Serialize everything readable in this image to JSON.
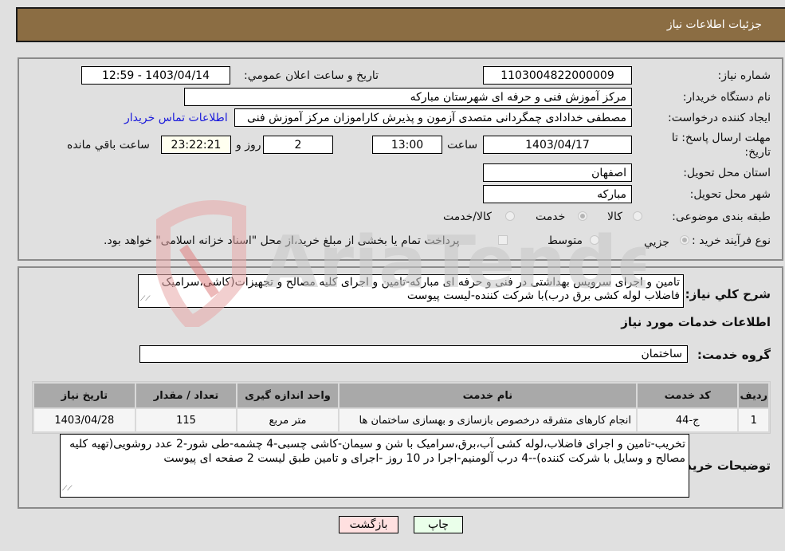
{
  "header": {
    "title": "جزئیات اطلاعات نیاز"
  },
  "form": {
    "need_number": {
      "label": "شماره نیاز:",
      "value": "1103004822000009"
    },
    "announce_datetime": {
      "label": "تاریخ و ساعت اعلان عمومي:",
      "value": "1403/04/14 - 12:59"
    },
    "buyer_org": {
      "label": "نام دستگاه خريدار:",
      "value": "مرکز آموزش فنی و حرفه ای شهرستان مبارکه"
    },
    "requester": {
      "label": "ایجاد کننده درخواست:",
      "value": "مصطفی خدادادی چمگردانی متصدی آزمون و پذیرش کاراموزان مرکز آموزش فنی",
      "contact_link": "اطلاعات تماس خريدار"
    },
    "deadline": {
      "label": "مهلت ارسال پاسخ: تا تاریخ:",
      "date": "1403/04/17",
      "time_label": "ساعت",
      "time": "13:00",
      "days": "2",
      "days_label": "روز و",
      "remaining": "23:22:21",
      "remaining_label": "ساعت باقي مانده"
    },
    "province": {
      "label": "استان محل تحویل:",
      "value": "اصفهان"
    },
    "city": {
      "label": "شهر محل تحویل:",
      "value": "مبارکه"
    },
    "category": {
      "label": "طبقه بندی موضوعی:",
      "options": [
        {
          "label": "کالا",
          "selected": false
        },
        {
          "label": "خدمت",
          "selected": true
        },
        {
          "label": "کالا/خدمت",
          "selected": false
        }
      ]
    },
    "purchase_type": {
      "label": "نوع فرآیند خرید :",
      "options": [
        {
          "label": "جزيي",
          "selected": true
        },
        {
          "label": "متوسط",
          "selected": false
        }
      ],
      "treasury_checkbox_label": "پرداخت تمام یا بخشی از مبلغ خرید،از محل \"اسناد خزانه اسلامی\" خواهد بود.",
      "treasury_checked": false
    }
  },
  "details": {
    "description_label": "شرح کلي نیاز:",
    "description": "تامین و اجرای سرویس بهداشتی در فنی و حرفه ای مبارکه-تامین و اجرای کلیه مصالح و تجهیزات(کاشی،سرامیک فاضلاب لوله کشی برق درب)با شرکت کننده-لیست پیوست",
    "services_title": "اطلاعات خدمات مورد نیاز",
    "service_group_label": "گروه خدمت:",
    "service_group": "ساختمان",
    "table": {
      "headers": [
        "رديف",
        "کد خدمت",
        "نام خدمت",
        "واحد اندازه گیری",
        "تعداد / مقدار",
        "تاریخ نیاز"
      ],
      "rows": [
        [
          "1",
          "ج-44",
          "انجام کارهای متفرقه درخصوص بازسازی و بهسازی ساختمان ها",
          "متر مربع",
          "115",
          "1403/04/28"
        ]
      ]
    },
    "buyer_notes_label": "توضيحات خريدار:",
    "buyer_notes": "تخریب-تامین و اجرای فاضلاب،لوله کشی آب،برق،سرامیک با شن و سیمان-کاشی چسبی-4 چشمه-طی شور-2 عدد روشویی(تهیه کلیه مصالح و وسایل با شرکت کننده)--4 درب آلومنیم-اجرا در 10 روز -اجرای و تامین طبق لیست 2 صفحه ای پیوست"
  },
  "buttons": {
    "print": "چاپ",
    "back": "بازگشت"
  },
  "watermark": {
    "text": "AriaTender.neT"
  }
}
